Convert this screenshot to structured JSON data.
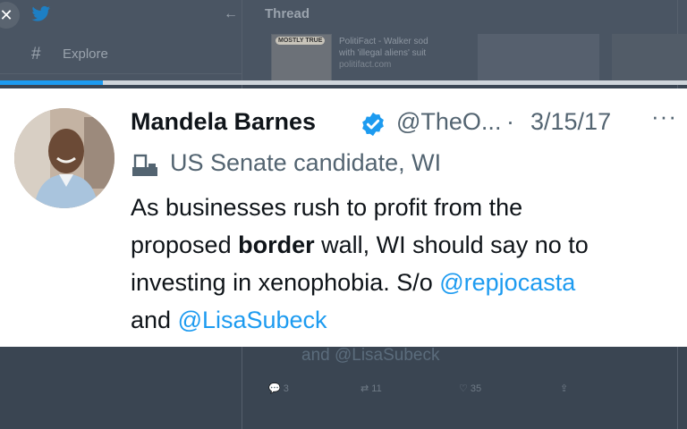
{
  "background": {
    "thread_title": "Thread",
    "nav_explore": "Explore",
    "card_title": "PolitiFact - Walker sod",
    "card_subtitle": "with 'illegal aliens' suit",
    "card_domain": "politifact.com",
    "card_stamp": "MOSTLY TRUE",
    "ghost_text": "and @LisaSubeck",
    "actions": {
      "reply": "3",
      "retweet": "11",
      "like": "35"
    }
  },
  "progress": {
    "fraction": 0.15,
    "color": "#1d9bf0"
  },
  "tweet": {
    "name": "Mandela Barnes",
    "handle": "@TheO...",
    "separator": "·",
    "date": "3/15/17",
    "more": "···",
    "label": "US Senate candidate, WI",
    "line1": "As businesses rush to profit from the",
    "line2_pre": "proposed ",
    "line2_bold": "border",
    "line2_post": " wall, WI should say no to",
    "line3_pre": "investing in xenophobia. S/o ",
    "mention1": "@repjocasta",
    "line4_pre": "and ",
    "mention2": "@LisaSubeck"
  },
  "icons": {
    "verified": "verified-badge-icon",
    "label": "ballot-box-icon",
    "close": "close-icon",
    "logo": "twitter-bird-icon"
  },
  "colors": {
    "accent": "#1d9bf0",
    "text": "#0f1419",
    "muted": "#536471"
  }
}
